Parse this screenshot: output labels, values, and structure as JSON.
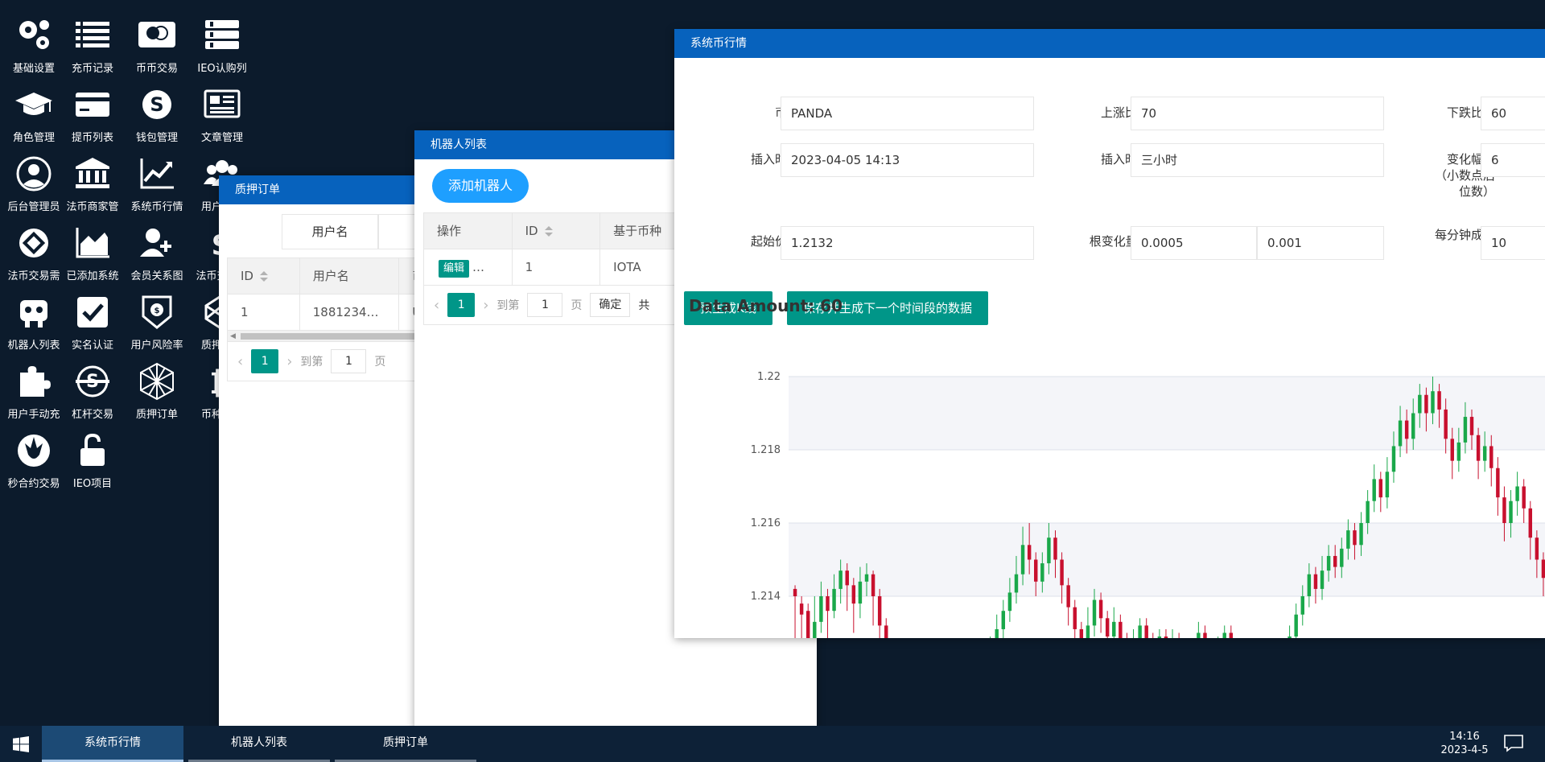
{
  "desktop_icons": [
    {
      "label": "基础设置",
      "icon": "gears-icon"
    },
    {
      "label": "充币记录",
      "icon": "list-icon"
    },
    {
      "label": "币币交易",
      "icon": "mastercard-icon"
    },
    {
      "label": "IEO认购列",
      "icon": "list-alt-icon"
    },
    {
      "label": "角色管理",
      "icon": "graduation-cap-icon"
    },
    {
      "label": "提币列表",
      "icon": "credit-card-icon"
    },
    {
      "label": "钱包管理",
      "icon": "skype-icon"
    },
    {
      "label": "文章管理",
      "icon": "newspaper-icon"
    },
    {
      "label": "后台管理员",
      "icon": "user-circle-icon"
    },
    {
      "label": "法币商家管",
      "icon": "bank-icon"
    },
    {
      "label": "系统币行情",
      "icon": "line-chart-icon"
    },
    {
      "label": "用户管理",
      "icon": "users-icon"
    },
    {
      "label": "法币交易需",
      "icon": "ring-logo-icon"
    },
    {
      "label": "已添加系统",
      "icon": "area-chart-icon"
    },
    {
      "label": "会员关系图",
      "icon": "user-plus-icon"
    },
    {
      "label": "法币交易订",
      "icon": "dollar-icon"
    },
    {
      "label": "机器人列表",
      "icon": "robot-icon"
    },
    {
      "label": "实名认证",
      "icon": "check-square-icon"
    },
    {
      "label": "用户风险率",
      "icon": "shield-coin-icon"
    },
    {
      "label": "质押配置",
      "icon": "codepen-icon"
    },
    {
      "label": "用户手动充",
      "icon": "puzzle-icon"
    },
    {
      "label": "杠杆交易",
      "icon": "strikethrough-coin-icon"
    },
    {
      "label": "质押订单",
      "icon": "hexagon-mesh-icon"
    },
    {
      "label": "币种管理",
      "icon": "bitcoin-icon"
    },
    {
      "label": "秒合约交易",
      "icon": "rebel-icon"
    },
    {
      "label": "IEO项目",
      "icon": "unlock-icon"
    }
  ],
  "pledge_window": {
    "title": "质押订单",
    "search_tab": "用户名",
    "columns": [
      "ID",
      "用户名",
      "币"
    ],
    "rows": [
      [
        "1",
        "1881234…",
        "US"
      ]
    ],
    "pager": {
      "current": "1",
      "goto_label": "到第",
      "goto_value": "1",
      "page_unit": "页"
    }
  },
  "robot_window": {
    "title": "机器人列表",
    "add_button": "添加机器人",
    "columns": [
      "操作",
      "ID",
      "基于币种"
    ],
    "rows": [
      {
        "edit": "编辑",
        "more": "…",
        "id": "1",
        "coin": "IOTA"
      }
    ],
    "pager": {
      "current": "1",
      "goto_label": "到第",
      "goto_value": "1",
      "page_unit": "页",
      "confirm": "确定",
      "total_prefix": "共"
    }
  },
  "market_window": {
    "title": "系统币行情",
    "fields": {
      "coin_label": "币种",
      "coin_value": "PANDA",
      "rise_label": "上涨比例",
      "rise_value": "70",
      "fall_label": "下跌比例",
      "fall_value": "60",
      "insert_time_label": "插入时间",
      "insert_time_value": "2023-04-05 14:13",
      "duration_label": "插入时长",
      "duration_value": "三小时",
      "decimal_label_1": "变化幅度",
      "decimal_label_2": "（小数点后",
      "decimal_label_3": "位数）",
      "decimal_value": "6",
      "start_price_label": "起始价格",
      "start_price_value": "1.2132",
      "change_label": "根变化量%",
      "change_min": "0.0005",
      "change_max": "0.001",
      "volume_label_1": "每分钟成交",
      "volume_label_2": "量",
      "volume_value": "10"
    },
    "buttons": {
      "pregen": "预生成K线",
      "save_next": "保存并生成下一个时间段的数据"
    },
    "data_amount": "Data Amount: 60"
  },
  "chart_data": {
    "type": "candlestick",
    "title": "",
    "xlabel": "",
    "ylabel": "",
    "yticks": [
      1.214,
      1.216,
      1.218,
      1.22
    ],
    "ylim": [
      1.2122,
      1.2205
    ],
    "grid": true,
    "up_color": "#1aa84a",
    "down_color": "#c8102e",
    "candles": [
      [
        1.2142,
        1.214,
        1.2143,
        1.2126
      ],
      [
        1.2138,
        1.2135,
        1.214,
        1.2125
      ],
      [
        1.2136,
        1.2128,
        1.2138,
        1.212
      ],
      [
        1.2128,
        1.2133,
        1.214,
        1.2124
      ],
      [
        1.2133,
        1.214,
        1.2144,
        1.213
      ],
      [
        1.214,
        1.2136,
        1.2142,
        1.2128
      ],
      [
        1.2136,
        1.2142,
        1.2146,
        1.2134
      ],
      [
        1.2142,
        1.2147,
        1.215,
        1.2138
      ],
      [
        1.2147,
        1.2143,
        1.2149,
        1.2136
      ],
      [
        1.2143,
        1.2138,
        1.2145,
        1.213
      ],
      [
        1.2138,
        1.2144,
        1.2148,
        1.2134
      ],
      [
        1.2144,
        1.2146,
        1.2149,
        1.214
      ],
      [
        1.2146,
        1.214,
        1.2147,
        1.2132
      ],
      [
        1.214,
        1.2132,
        1.2142,
        1.2126
      ],
      [
        1.2132,
        1.2126,
        1.2134,
        1.212
      ],
      [
        1.2126,
        1.2122,
        1.2128,
        1.2116
      ],
      [
        1.2122,
        1.2118,
        1.2124,
        1.2112
      ],
      [
        1.2118,
        1.2114,
        1.212,
        1.2108
      ],
      [
        1.2114,
        1.211,
        1.2116,
        1.2104
      ],
      [
        1.211,
        1.2108,
        1.2113,
        1.2102
      ],
      [
        1.2108,
        1.2112,
        1.2115,
        1.2104
      ],
      [
        1.2112,
        1.2108,
        1.2114,
        1.2102
      ],
      [
        1.2108,
        1.2112,
        1.2115,
        1.2103
      ],
      [
        1.2112,
        1.2116,
        1.2118,
        1.2108
      ],
      [
        1.2116,
        1.2112,
        1.2118,
        1.2107
      ],
      [
        1.2112,
        1.2118,
        1.2122,
        1.2109
      ],
      [
        1.2118,
        1.2114,
        1.212,
        1.2109
      ],
      [
        1.2114,
        1.212,
        1.2124,
        1.2111
      ],
      [
        1.212,
        1.2125,
        1.2128,
        1.2117
      ],
      [
        1.2125,
        1.2122,
        1.2127,
        1.2116
      ],
      [
        1.2122,
        1.2126,
        1.2129,
        1.2119
      ],
      [
        1.2126,
        1.2131,
        1.2135,
        1.2123
      ],
      [
        1.2131,
        1.2136,
        1.2139,
        1.2128
      ],
      [
        1.2136,
        1.2141,
        1.2145,
        1.2133
      ],
      [
        1.2141,
        1.2146,
        1.2151,
        1.2138
      ],
      [
        1.2146,
        1.2154,
        1.2159,
        1.2143
      ],
      [
        1.2154,
        1.215,
        1.216,
        1.2146
      ],
      [
        1.215,
        1.2144,
        1.2152,
        1.214
      ],
      [
        1.2144,
        1.2149,
        1.2152,
        1.2141
      ],
      [
        1.2149,
        1.2156,
        1.216,
        1.2146
      ],
      [
        1.2156,
        1.215,
        1.2158,
        1.2145
      ],
      [
        1.215,
        1.2143,
        1.2152,
        1.2138
      ],
      [
        1.2143,
        1.2137,
        1.2145,
        1.2132
      ],
      [
        1.2137,
        1.2131,
        1.2139,
        1.2126
      ],
      [
        1.2131,
        1.2126,
        1.2133,
        1.2122
      ],
      [
        1.2126,
        1.2132,
        1.2137,
        1.2124
      ],
      [
        1.2132,
        1.2139,
        1.2142,
        1.2129
      ],
      [
        1.2139,
        1.2134,
        1.2141,
        1.213
      ],
      [
        1.2134,
        1.2129,
        1.2136,
        1.2124
      ],
      [
        1.2129,
        1.2133,
        1.2137,
        1.2126
      ],
      [
        1.2133,
        1.2128,
        1.2135,
        1.2124
      ],
      [
        1.2128,
        1.2123,
        1.213,
        1.212
      ],
      [
        1.2123,
        1.2127,
        1.2131,
        1.2121
      ],
      [
        1.2127,
        1.2132,
        1.2134,
        1.2124
      ],
      [
        1.2132,
        1.2128,
        1.2134,
        1.2124
      ],
      [
        1.2128,
        1.2125,
        1.213,
        1.2121
      ],
      [
        1.2125,
        1.2129,
        1.2131,
        1.2122
      ],
      [
        1.2129,
        1.2124,
        1.2131,
        1.2121
      ],
      [
        1.2124,
        1.2128,
        1.2131,
        1.2122
      ],
      [
        1.2128,
        1.2124,
        1.213,
        1.2121
      ],
      [
        1.2124,
        1.2121,
        1.2126,
        1.2118
      ],
      [
        1.2121,
        1.2125,
        1.2128,
        1.2119
      ],
      [
        1.2125,
        1.213,
        1.2133,
        1.2122
      ],
      [
        1.213,
        1.2126,
        1.2132,
        1.2122
      ],
      [
        1.2126,
        1.2122,
        1.2128,
        1.2119
      ],
      [
        1.2122,
        1.2126,
        1.2129,
        1.212
      ],
      [
        1.2126,
        1.213,
        1.2132,
        1.2123
      ],
      [
        1.213,
        1.2126,
        1.2132,
        1.2123
      ],
      [
        1.2126,
        1.2122,
        1.2128,
        1.2118
      ],
      [
        1.2122,
        1.2119,
        1.2124,
        1.2116
      ],
      [
        1.2119,
        1.2122,
        1.2125,
        1.2117
      ],
      [
        1.2122,
        1.2125,
        1.2128,
        1.212
      ],
      [
        1.2125,
        1.2121,
        1.2127,
        1.2118
      ],
      [
        1.2121,
        1.2118,
        1.2123,
        1.2115
      ],
      [
        1.2118,
        1.2121,
        1.2124,
        1.2116
      ],
      [
        1.2121,
        1.2125,
        1.2128,
        1.2119
      ],
      [
        1.2125,
        1.2129,
        1.2132,
        1.2123
      ],
      [
        1.2129,
        1.2135,
        1.2138,
        1.2127
      ],
      [
        1.2135,
        1.214,
        1.2143,
        1.2132
      ],
      [
        1.214,
        1.2146,
        1.2149,
        1.2137
      ],
      [
        1.2146,
        1.2142,
        1.2148,
        1.2138
      ],
      [
        1.2142,
        1.2147,
        1.2151,
        1.2139
      ],
      [
        1.2147,
        1.2151,
        1.2154,
        1.2144
      ],
      [
        1.2151,
        1.2148,
        1.2154,
        1.2145
      ],
      [
        1.2148,
        1.2153,
        1.2156,
        1.2145
      ],
      [
        1.2153,
        1.2158,
        1.2161,
        1.215
      ],
      [
        1.2158,
        1.2154,
        1.216,
        1.215
      ],
      [
        1.2154,
        1.216,
        1.2163,
        1.2151
      ],
      [
        1.216,
        1.2166,
        1.2169,
        1.2157
      ],
      [
        1.2166,
        1.2172,
        1.2176,
        1.2163
      ],
      [
        1.2172,
        1.2167,
        1.2174,
        1.2163
      ],
      [
        1.2167,
        1.2174,
        1.2178,
        1.2164
      ],
      [
        1.2174,
        1.2181,
        1.2185,
        1.2171
      ],
      [
        1.2181,
        1.2188,
        1.2192,
        1.2178
      ],
      [
        1.2188,
        1.2183,
        1.2191,
        1.2179
      ],
      [
        1.2183,
        1.219,
        1.2194,
        1.218
      ],
      [
        1.219,
        1.2195,
        1.2198,
        1.2186
      ],
      [
        1.2195,
        1.219,
        1.2197,
        1.2185
      ],
      [
        1.219,
        1.2196,
        1.22,
        1.2187
      ],
      [
        1.2196,
        1.2191,
        1.2198,
        1.2186
      ],
      [
        1.2191,
        1.2183,
        1.2194,
        1.2179
      ],
      [
        1.2183,
        1.2177,
        1.2186,
        1.2172
      ],
      [
        1.2177,
        1.2182,
        1.2186,
        1.2174
      ],
      [
        1.2182,
        1.2189,
        1.2193,
        1.2179
      ],
      [
        1.2189,
        1.2184,
        1.2191,
        1.218
      ],
      [
        1.2184,
        1.2177,
        1.2186,
        1.2172
      ],
      [
        1.2177,
        1.2181,
        1.2185,
        1.2174
      ],
      [
        1.2181,
        1.2175,
        1.2184,
        1.217
      ],
      [
        1.2175,
        1.2167,
        1.2178,
        1.2162
      ],
      [
        1.2167,
        1.216,
        1.217,
        1.2155
      ],
      [
        1.216,
        1.2166,
        1.2169,
        1.2156
      ],
      [
        1.2166,
        1.217,
        1.2174,
        1.2162
      ],
      [
        1.217,
        1.2164,
        1.2172,
        1.216
      ],
      [
        1.2164,
        1.2156,
        1.2166,
        1.215
      ],
      [
        1.2156,
        1.215,
        1.2158,
        1.2145
      ],
      [
        1.215,
        1.2145,
        1.2152,
        1.214
      ]
    ]
  },
  "taskbar": {
    "tasks": [
      "系统币行情",
      "机器人列表",
      "质押订单"
    ],
    "time": "14:16",
    "date": "2023-4-5"
  }
}
